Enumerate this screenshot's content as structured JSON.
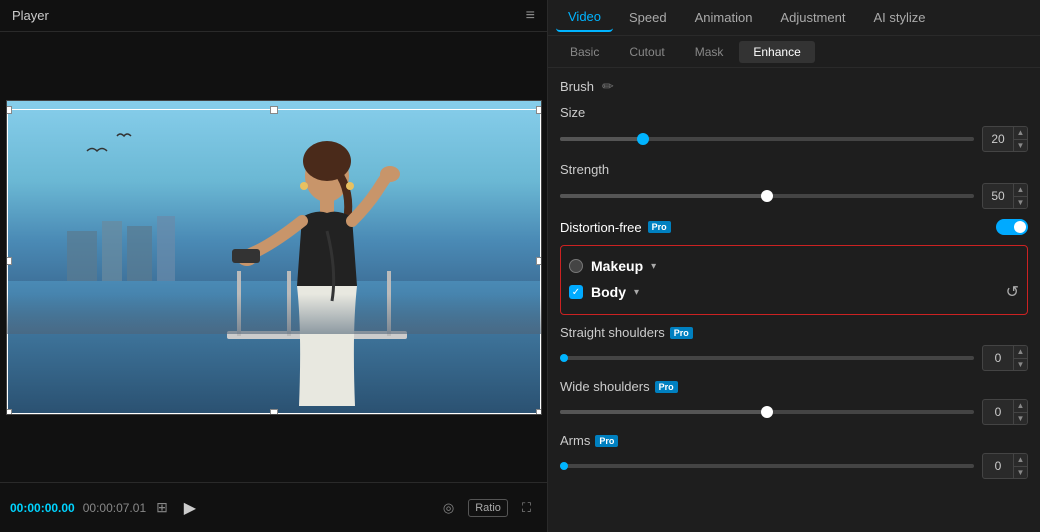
{
  "player": {
    "title": "Player",
    "time_current": "00:00:00.00",
    "time_total": "00:00:07.01"
  },
  "tabs": {
    "items": [
      {
        "id": "video",
        "label": "Video",
        "active": true
      },
      {
        "id": "speed",
        "label": "Speed",
        "active": false
      },
      {
        "id": "animation",
        "label": "Animation",
        "active": false
      },
      {
        "id": "adjustment",
        "label": "Adjustment",
        "active": false
      },
      {
        "id": "ai-stylize",
        "label": "AI stylize",
        "active": false
      }
    ]
  },
  "sub_tabs": {
    "items": [
      {
        "id": "basic",
        "label": "Basic",
        "active": false
      },
      {
        "id": "cutout",
        "label": "Cutout",
        "active": false
      },
      {
        "id": "mask",
        "label": "Mask",
        "active": false
      },
      {
        "id": "enhance",
        "label": "Enhance",
        "active": true
      }
    ]
  },
  "enhance": {
    "brush_label": "Brush",
    "size_label": "Size",
    "size_value": "20",
    "strength_label": "Strength",
    "strength_value": "50",
    "distortion_free_label": "Distortion-free",
    "makeup_label": "Makeup",
    "body_label": "Body",
    "straight_shoulders_label": "Straight shoulders",
    "straight_shoulders_value": "0",
    "wide_shoulders_label": "Wide shoulders",
    "wide_shoulders_value": "0",
    "arms_label": "Arms",
    "arms_value": "0",
    "reset_tooltip": "Reset"
  },
  "controls": {
    "play_label": "▶",
    "ratio_label": "Ratio"
  }
}
